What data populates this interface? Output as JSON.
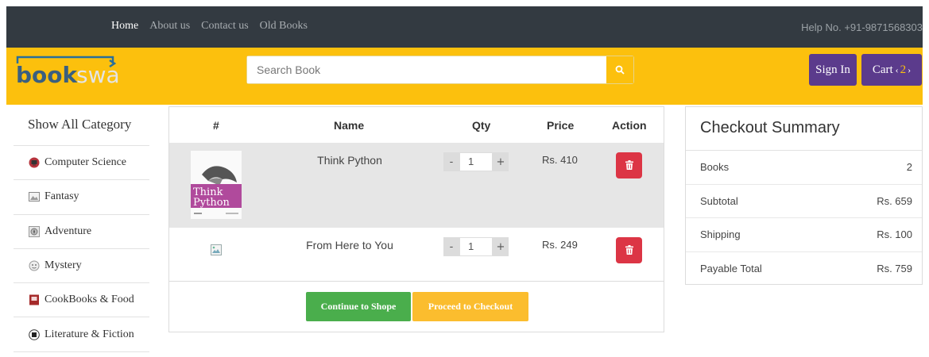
{
  "topnav": {
    "links": [
      "Home",
      "About us",
      "Contact us",
      "Old Books"
    ],
    "help": "Help No. +91-9871568303"
  },
  "header": {
    "logo_text_dark": "book",
    "logo_text_light": "swap",
    "search_placeholder": "Search Book",
    "signin_label": "Sign In",
    "cart_label": "Cart",
    "cart_count": "2",
    "colors": {
      "brand_yellow": "#fcc00d",
      "nav_dark": "#333a41",
      "purple": "#5b3b8c"
    }
  },
  "sidebar": {
    "title": "Show All Category",
    "items": [
      {
        "label": "Computer Science",
        "icon": "computer-icon"
      },
      {
        "label": "Fantasy",
        "icon": "landscape-icon"
      },
      {
        "label": "Adventure",
        "icon": "compass-icon"
      },
      {
        "label": "Mystery",
        "icon": "mask-icon"
      },
      {
        "label": "CookBooks & Food",
        "icon": "cookbook-icon"
      },
      {
        "label": "Literature & Fiction",
        "icon": "book-icon"
      }
    ]
  },
  "cart": {
    "headers": [
      "#",
      "Name",
      "Qty",
      "Price",
      "Action"
    ],
    "rows": [
      {
        "name": "Think Python",
        "qty": "1",
        "price": "Rs. 410",
        "cover_title_1": "Think",
        "cover_title_2": "Python"
      },
      {
        "name": "From Here to You",
        "qty": "1",
        "price": "Rs. 249"
      }
    ],
    "qty_minus": "-",
    "qty_plus": "+",
    "continue_label": "Continue to Shope",
    "checkout_label": "Proceed to Checkout"
  },
  "summary": {
    "title": "Checkout Summary",
    "rows": [
      {
        "label": "Books",
        "value": "2"
      },
      {
        "label": "Subtotal",
        "value": "Rs. 659"
      },
      {
        "label": "Shipping",
        "value": "Rs. 100"
      },
      {
        "label": "Payable Total",
        "value": "Rs. 759"
      }
    ]
  }
}
